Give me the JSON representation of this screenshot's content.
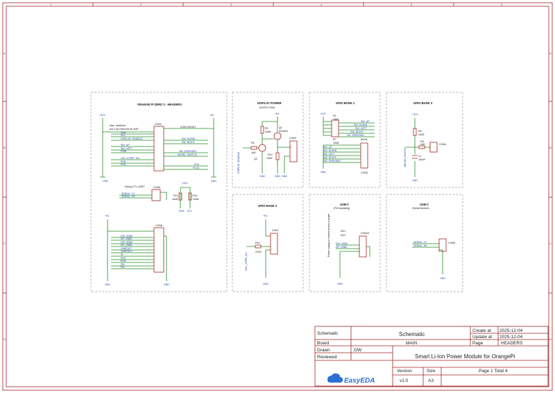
{
  "grid": {
    "columns": [
      "1",
      "2",
      "3",
      "4",
      "5",
      "6"
    ],
    "rows": [
      "A",
      "B",
      "C",
      "D"
    ]
  },
  "blocks": {
    "headers": {
      "title": "ORANGE PI ZERO 2 - HEADERS",
      "note1": "Max. i4a00mA",
      "note2": "but 2.4A reserved for WiFi",
      "pwr_left": "+3V3",
      "pwr_right": "+5V",
      "con_ref": "CON1",
      "con_note": "5.00V IN/OUT",
      "left_nets": [
        "SDA",
        "SCL",
        "DISPLAY_ENABLE",
        "SW_UP",
        "SW_LEFT",
        "PWR",
        "LED_STRIP_Din",
        "PH6",
        "PH8"
      ],
      "right_nets": [
        "SW_DOWN",
        "SW_RIGHT",
        "SW_PRESSED",
        "MICRO_SWITCH",
        "PH4",
        "PC10"
      ],
      "gnd": "GND",
      "uart_title": "Debug TTL UART",
      "uart_ref": "CON5",
      "uart_nets": [
        "SERIAL_TX",
        "SERIAL_RX"
      ],
      "r11": "R11",
      "r11_val": "10kΩ",
      "r12": "R12",
      "r12_val": "10kΩ",
      "r_nets": [
        "SDA",
        "SCL"
      ],
      "con8_ref": "CON8",
      "con8_nets": [
        "DM_USB2",
        "DP_USB2",
        "DM_USB3",
        "DP_USB3",
        "LINEOUT",
        "LINEOUTL",
        "IR",
        "PH9",
        "PI10",
        "PI8",
        "PI6"
      ]
    },
    "display": {
      "title": "DISPLAY POWER",
      "subtitle": "(5.00V/1.50A)",
      "pwr": "+5V",
      "q1": "Q1",
      "q1_val": "AO3401",
      "q2": "Q2",
      "r2": "R2",
      "r2_val": "10kΩ",
      "r3": "R3",
      "r3_val": "1kΩ",
      "r10": "R10",
      "r10_val": "10kΩ",
      "con": "CON2",
      "net": "DISPLAY_ENABLE",
      "gnd": "GND"
    },
    "gpio1": {
      "title": "GPIO BANK 1",
      "pwr": "+3V3",
      "r1": "R1",
      "r1_val": "10kΩ",
      "r7": "R7",
      "r7_val": "10kΩ",
      "r_note": "8x10k",
      "nets_top": [
        "SW_UP",
        "SW_DOWN",
        "SW_LEFT",
        "SW_RIGHT",
        "SW_PRESSED"
      ],
      "nets_bottom": [
        "SW_UP",
        "SW_DOWN",
        "SW_LEFT",
        "SW_RIGHT",
        "SW_PRESSED"
      ],
      "con": "CON3",
      "gnd": "GND"
    },
    "gpio3": {
      "title": "GPIO BANK 3",
      "pwr": "+3V3",
      "r6": "R6",
      "r6_val": "10kΩ",
      "r5": "R5",
      "r5_val": "1kΩ",
      "c1": "C1",
      "c1_val": "100nF",
      "net": "MICRO_SWITCH",
      "con": "CON4",
      "gnd": "GND"
    },
    "gpio2": {
      "title": "GPIO BANK 2",
      "pwr": "+5V",
      "r14": "R14",
      "r14_val": "470Ω",
      "net": "LED_STRIP_Din",
      "con": "CON7",
      "gnd": "GND"
    },
    "usbfw": {
      "title": "USB-C",
      "subtitle": "(FW Updating)",
      "note": "Power supply is shared across a single",
      "con": "CON10",
      "nc1": "NC1",
      "nc2": "NC2",
      "nets": [
        "DM_USB2",
        "DP_USB2"
      ],
      "gnd": "GND"
    },
    "usbmon": {
      "title": "USB-C",
      "subtitle": "(Serial Monitor)",
      "con": "CON6",
      "nets": [
        "SERIAL_TX",
        "SERIAL_RX"
      ],
      "gnd": "GND"
    }
  },
  "title_block": {
    "schematic_label": "Schematic",
    "schematic_value": "Schematic",
    "create_label": "Create at",
    "create_value": "2025-12-04",
    "update_label": "Update at",
    "update_value": "2025-12-04",
    "board_label": "Board",
    "board_value": "MAIN",
    "page_label": "Page",
    "page_value": "HEADERS",
    "drawn_label": "Drawn",
    "drawn_value": "GW",
    "reviewed_label": "Reviewed",
    "project_title": "Smart Li-Ion Power Module for OrangePi",
    "version_label": "Version",
    "size_label": "Size",
    "version_value": "v1.0",
    "size_value": "A3",
    "page_count": "Page  1  Total  4",
    "logo": "EasyEDA"
  },
  "colors": {
    "frame": "#a02020",
    "wire": "#1f8a1f",
    "net_label": "#1a3fa8",
    "dash": "#9a9a9a"
  }
}
